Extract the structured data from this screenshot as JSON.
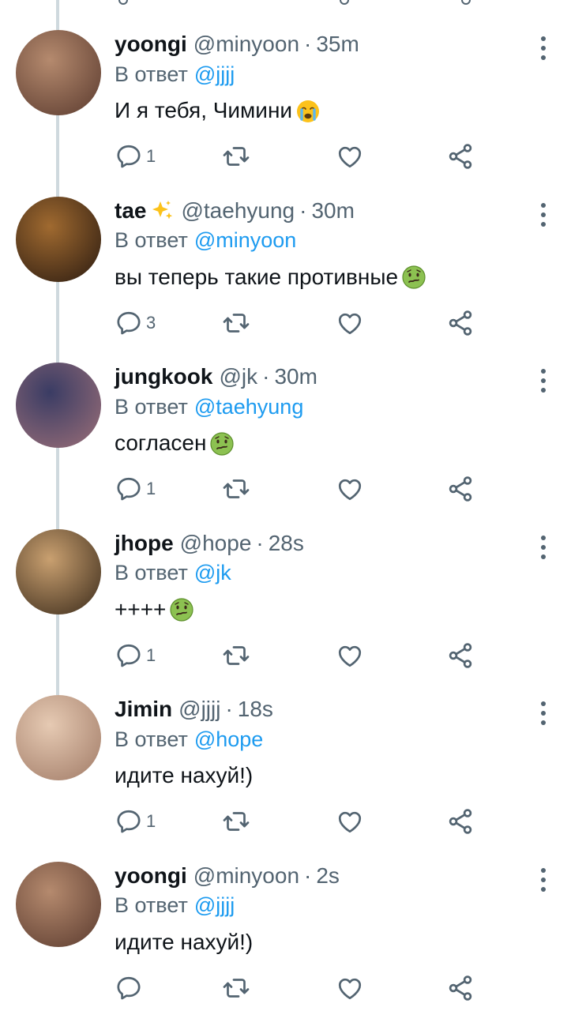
{
  "tweets": [
    {
      "name": "yoongi",
      "name_emoji": "",
      "handle": "@minyoon",
      "time": "35m",
      "reply_label": "В ответ",
      "reply_to": "@jjjj",
      "text": "И я тебя, Чимини",
      "text_emoji": "crying-face",
      "reply_count": "1",
      "avatar_colors": [
        "#b58a6e",
        "#5a3a2e"
      ]
    },
    {
      "name": "tae",
      "name_emoji": "sparkles",
      "handle": "@taehyung",
      "time": "30m",
      "reply_label": "В ответ",
      "reply_to": "@minyoon",
      "text": "вы теперь такие противные",
      "text_emoji": "nauseated-face",
      "reply_count": "3",
      "avatar_colors": [
        "#a06a30",
        "#2a1a10"
      ]
    },
    {
      "name": "jungkook",
      "name_emoji": "",
      "handle": "@jk",
      "time": "30m",
      "reply_label": "В ответ",
      "reply_to": "@taehyung",
      "text": "согласен",
      "text_emoji": "nauseated-face",
      "reply_count": "1",
      "avatar_colors": [
        "#3a3c64",
        "#9c6f78"
      ]
    },
    {
      "name": "jhope",
      "name_emoji": "",
      "handle": "@hope",
      "time": "28s",
      "reply_label": "В ответ",
      "reply_to": "@jk",
      "text": "++++",
      "text_emoji": "nauseated-face",
      "reply_count": "1",
      "avatar_colors": [
        "#c9a070",
        "#3a2a1a"
      ]
    },
    {
      "name": "Jimin",
      "name_emoji": "",
      "handle": "@jjjj",
      "time": "18s",
      "reply_label": "В ответ",
      "reply_to": "@hope",
      "text": "идите нахуй!)",
      "text_emoji": "",
      "reply_count": "1",
      "avatar_colors": [
        "#e6cab3",
        "#a07a66"
      ]
    },
    {
      "name": "yoongi",
      "name_emoji": "",
      "handle": "@minyoon",
      "time": "2s",
      "reply_label": "В ответ",
      "reply_to": "@jjjj",
      "text": "идите нахуй!)",
      "text_emoji": "",
      "reply_count": "",
      "avatar_colors": [
        "#b58a6e",
        "#5a3a2e"
      ]
    }
  ],
  "icons": {
    "reply": "reply-icon",
    "retweet": "retweet-icon",
    "like": "heart-icon",
    "share": "share-icon",
    "more": "more-options-icon"
  },
  "colors": {
    "text": "#0f1419",
    "secondary": "#536471",
    "link": "#1d9bf0",
    "thread_line": "#cfd9de"
  }
}
